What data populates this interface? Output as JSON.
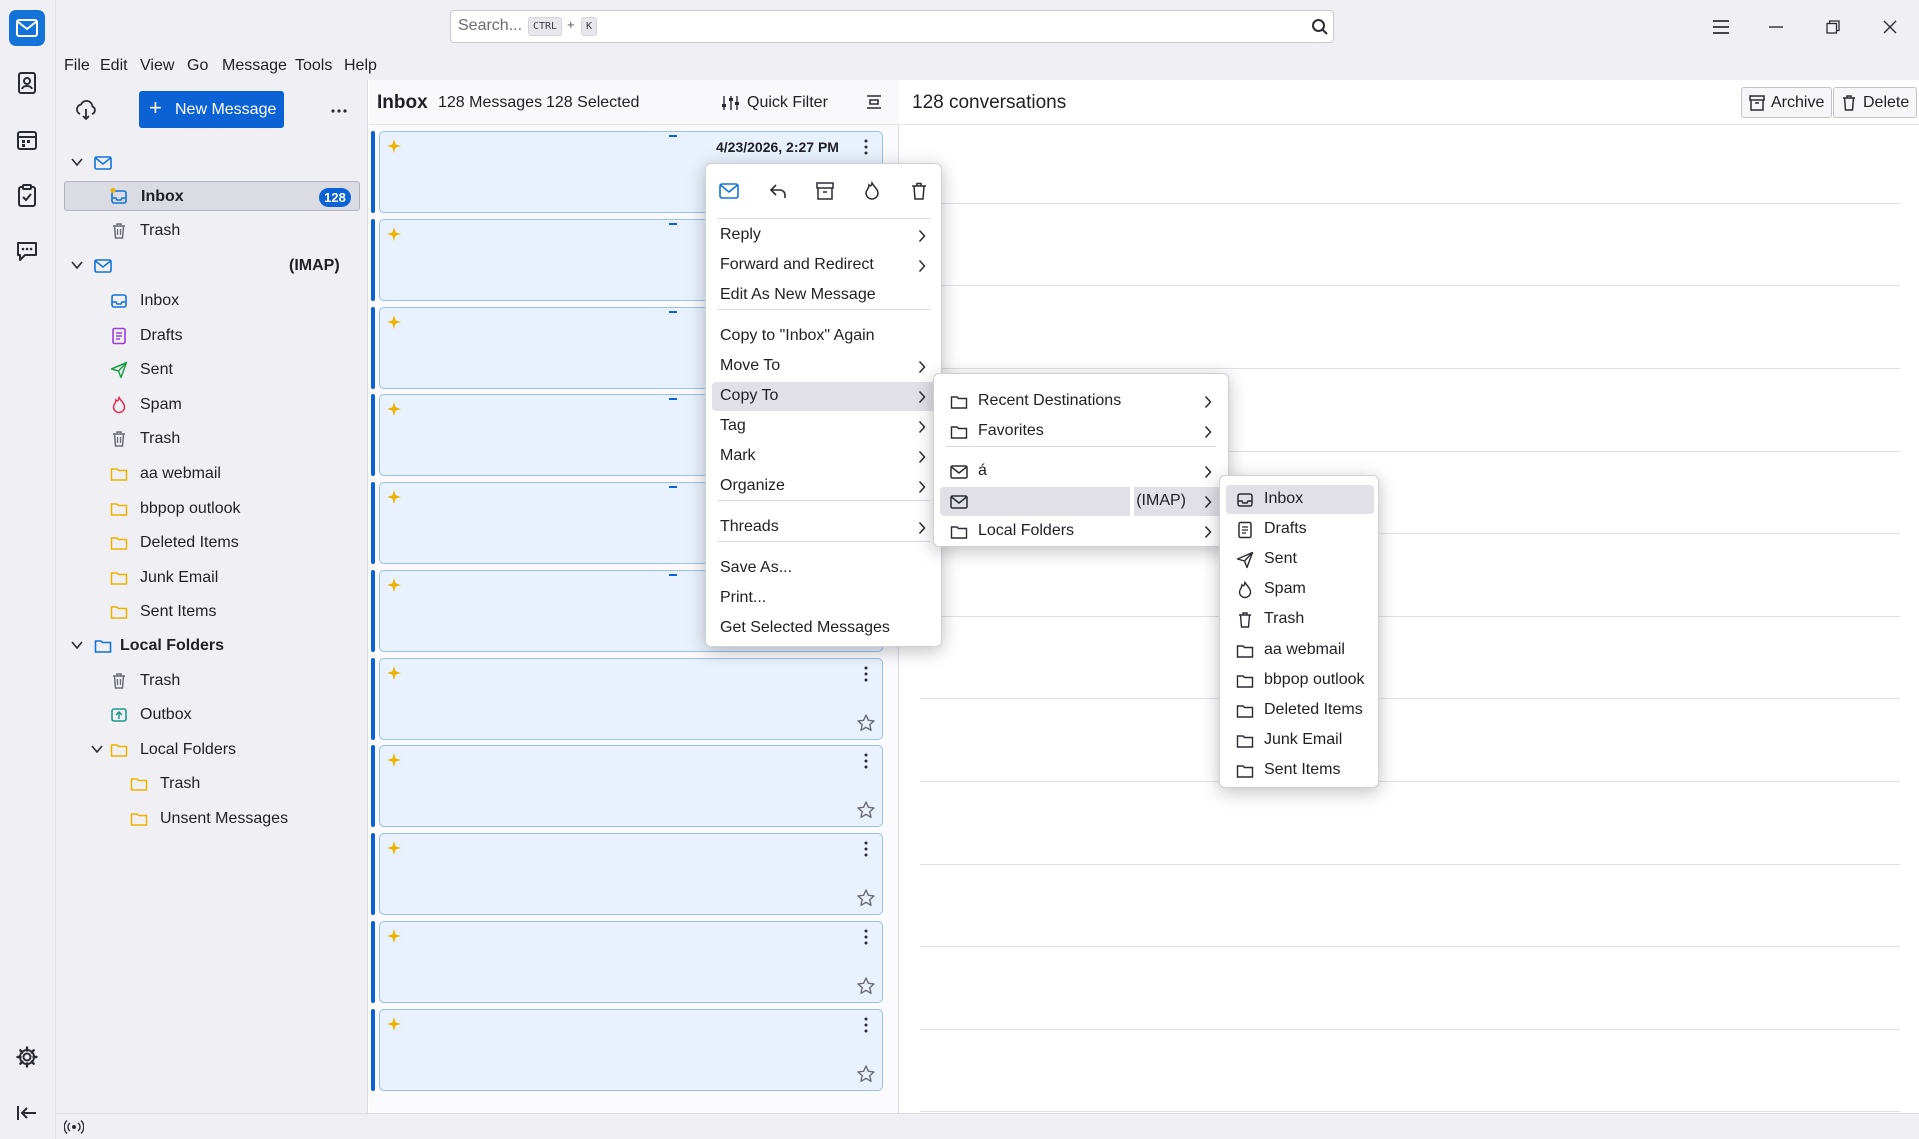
{
  "window": {
    "search_placeholder": "Search...",
    "kbd_ctrl": "CTRL",
    "kbd_plus": "+",
    "kbd_k": "K"
  },
  "menubar": [
    "File",
    "Edit",
    "View",
    "Go",
    "Message",
    "Tools",
    "Help"
  ],
  "folder_pane": {
    "new_message": "New Message",
    "accounts": [
      {
        "label": "",
        "folders": [
          {
            "label": "Inbox",
            "icon": "inbox-icon",
            "badge": "128",
            "selected": true
          },
          {
            "label": "Trash",
            "icon": "trash-icon"
          }
        ]
      },
      {
        "label": "(IMAP)",
        "folders": [
          {
            "label": "Inbox",
            "icon": "inbox-icon"
          },
          {
            "label": "Drafts",
            "icon": "drafts-icon"
          },
          {
            "label": "Sent",
            "icon": "sent-icon"
          },
          {
            "label": "Spam",
            "icon": "spam-icon"
          },
          {
            "label": "Trash",
            "icon": "trash-icon"
          },
          {
            "label": "aa webmail",
            "icon": "folder-icon"
          },
          {
            "label": "bbpop outlook",
            "icon": "folder-icon"
          },
          {
            "label": "Deleted Items",
            "icon": "folder-icon"
          },
          {
            "label": "Junk Email",
            "icon": "folder-icon"
          },
          {
            "label": "Sent Items",
            "icon": "folder-icon"
          }
        ]
      },
      {
        "label": "Local Folders",
        "folders": [
          {
            "label": "Trash",
            "icon": "trash-icon"
          },
          {
            "label": "Outbox",
            "icon": "outbox-icon"
          },
          {
            "label": "Local Folders",
            "icon": "folder-icon"
          },
          {
            "label": "Trash",
            "icon": "folder-icon"
          },
          {
            "label": "Unsent Messages",
            "icon": "folder-icon"
          }
        ]
      }
    ]
  },
  "message_list": {
    "folder": "Inbox",
    "count": "128 Messages",
    "selected": "128 Selected",
    "quick_filter": "Quick Filter",
    "first_date": "4/23/2026, 2:27 PM"
  },
  "preview": {
    "title": "128 conversations",
    "archive": "Archive",
    "delete": "Delete"
  },
  "context_menu": {
    "items": [
      {
        "label": "Reply",
        "submenu": true
      },
      {
        "label": "Forward and Redirect",
        "submenu": true
      },
      {
        "label": "Edit As New Message"
      },
      {
        "label": "Copy to \"Inbox\" Again"
      },
      {
        "label": "Move To",
        "submenu": true
      },
      {
        "label": "Copy To",
        "submenu": true,
        "highlighted": true
      },
      {
        "label": "Tag",
        "submenu": true
      },
      {
        "label": "Mark",
        "submenu": true
      },
      {
        "label": "Organize",
        "submenu": true
      },
      {
        "label": "Threads",
        "submenu": true
      },
      {
        "label": "Save As..."
      },
      {
        "label": "Print..."
      },
      {
        "label": "Get Selected Messages"
      }
    ]
  },
  "copy_to_menu": {
    "items": [
      {
        "label": "Recent Destinations"
      },
      {
        "label": "Favorites"
      },
      {
        "label": "á"
      },
      {
        "label": "(IMAP)",
        "highlighted": true
      },
      {
        "label": "Local Folders"
      }
    ]
  },
  "imap_menu": {
    "items": [
      {
        "label": "Inbox",
        "icon": "inbox-icon",
        "highlighted": true
      },
      {
        "label": "Drafts",
        "icon": "drafts-icon"
      },
      {
        "label": "Sent",
        "icon": "sent-icon"
      },
      {
        "label": "Spam",
        "icon": "spam-icon"
      },
      {
        "label": "Trash",
        "icon": "trash-icon"
      },
      {
        "label": "aa webmail",
        "icon": "folder-icon"
      },
      {
        "label": "bbpop outlook",
        "icon": "folder-icon"
      },
      {
        "label": "Deleted Items",
        "icon": "folder-icon"
      },
      {
        "label": "Junk Email",
        "icon": "folder-icon"
      },
      {
        "label": "Sent Items",
        "icon": "folder-icon"
      }
    ]
  },
  "colors": {
    "accent": "#0b62d5",
    "chrome": "#f0f0f4",
    "card": "#e9f1fc",
    "star": "#e9b300"
  }
}
